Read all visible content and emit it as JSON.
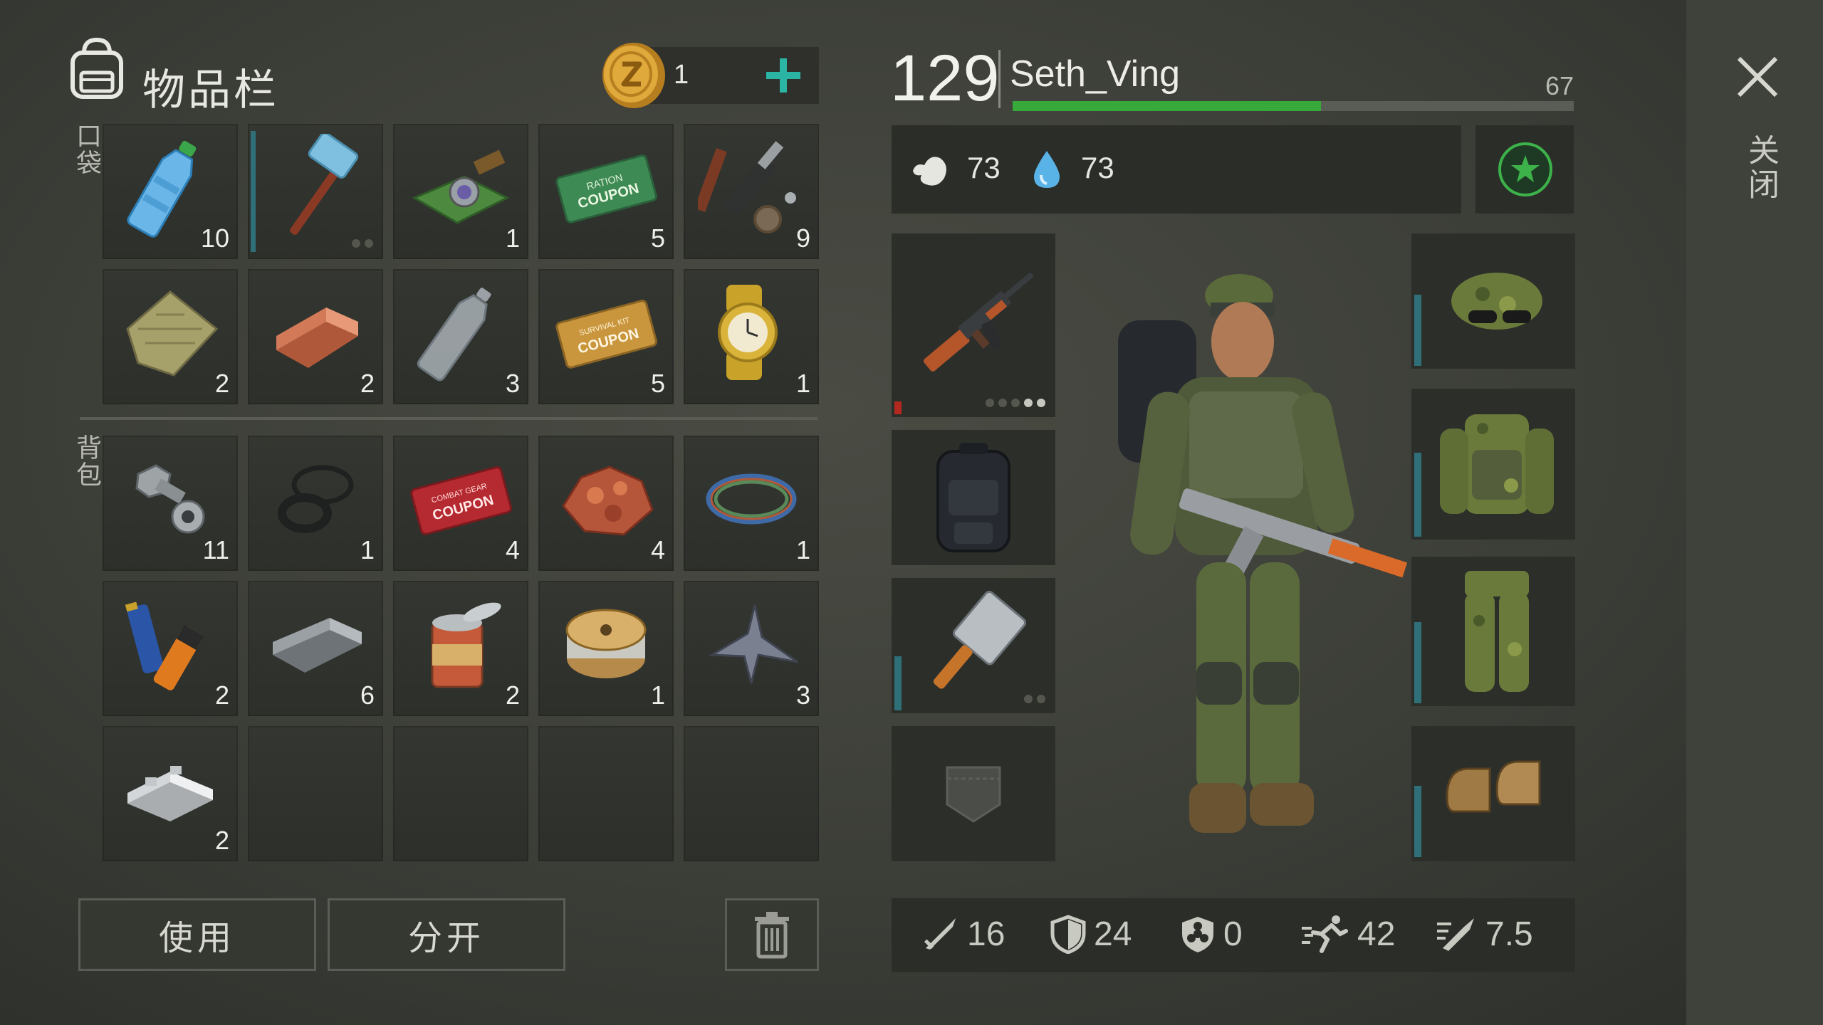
{
  "inventory": {
    "title": "物品栏",
    "coins": "1",
    "pocket_label": "口袋",
    "backpack_label": "背包",
    "pocket_slots": [
      {
        "item": "water-bottle",
        "count": "10"
      },
      {
        "item": "hammer",
        "count": ""
      },
      {
        "item": "camera-module",
        "count": "1"
      },
      {
        "item": "ration-coupon",
        "count": "5",
        "coupon_text": "RATION COUPON"
      },
      {
        "item": "parts-scrap",
        "count": "9"
      },
      {
        "item": "cloth-scrap",
        "count": "2"
      },
      {
        "item": "copper-bar",
        "count": "2"
      },
      {
        "item": "empty-bottle",
        "count": "3"
      },
      {
        "item": "survival-kit-coupon",
        "count": "5",
        "coupon_text": "SURVIVAL KIT COUPON"
      },
      {
        "item": "gold-watch",
        "count": "1"
      }
    ],
    "backpack_slots": [
      {
        "item": "bolt-nut",
        "count": "11"
      },
      {
        "item": "rubber-rings",
        "count": "1"
      },
      {
        "item": "combat-gear-coupon",
        "count": "4",
        "coupon_text": "COMBAT GEAR COUPON"
      },
      {
        "item": "copper-ore",
        "count": "4"
      },
      {
        "item": "wire-coil",
        "count": "1"
      },
      {
        "item": "batteries",
        "count": "2"
      },
      {
        "item": "iron-ingot",
        "count": "6"
      },
      {
        "item": "tin-can",
        "count": "2"
      },
      {
        "item": "wire-spool",
        "count": "1"
      },
      {
        "item": "metal-scrap",
        "count": "3"
      },
      {
        "item": "aluminum-bars",
        "count": "2"
      }
    ],
    "use_label": "使用",
    "split_label": "分开"
  },
  "player": {
    "level": "129",
    "name": "Seth_Ving",
    "xp_value": "67",
    "xp_progress": 0.55,
    "hunger": "73",
    "thirst": "73"
  },
  "stats": {
    "attack": "16",
    "armor": "24",
    "bio_protection": "0",
    "speed": "42",
    "stealth": "7.5"
  },
  "close_label": "关闭",
  "colors": {
    "accent_green": "#3db24a",
    "xp_green": "#37a93a",
    "durability": "#2f6f77",
    "coin_gold": "#d6a23a",
    "plus_teal": "#2bb3a3"
  }
}
